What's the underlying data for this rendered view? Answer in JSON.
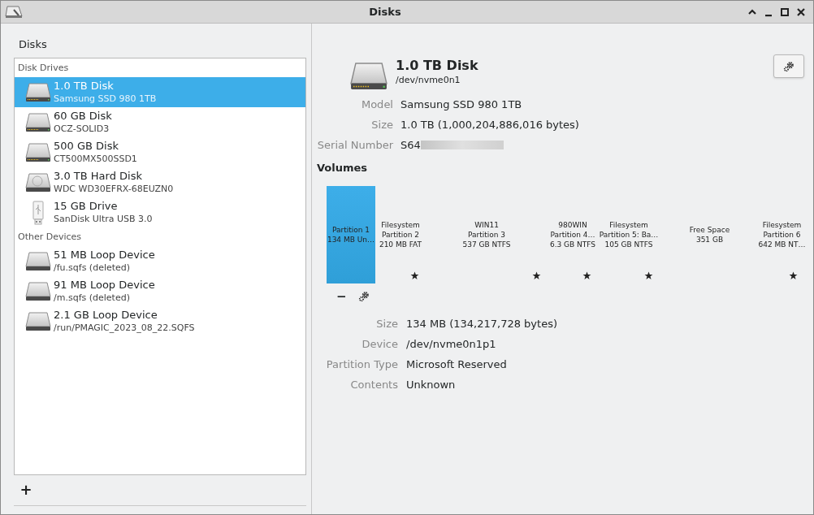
{
  "window": {
    "title": "Disks"
  },
  "heading": "Disks",
  "sections": [
    {
      "title": "Disk Drives",
      "items": [
        {
          "kind": "ssd",
          "name": "1.0 TB Disk",
          "detail": "Samsung SSD 980 1TB",
          "selected": true
        },
        {
          "kind": "ssd",
          "name": "60 GB Disk",
          "detail": "OCZ-SOLID3",
          "selected": false
        },
        {
          "kind": "ssd",
          "name": "500 GB Disk",
          "detail": "CT500MX500SSD1",
          "selected": false
        },
        {
          "kind": "hdd",
          "name": "3.0 TB Hard Disk",
          "detail": "WDC WD30EFRX-68EUZN0",
          "selected": false
        },
        {
          "kind": "usb",
          "name": "15 GB Drive",
          "detail": "SanDisk Ultra USB 3.0",
          "selected": false
        }
      ]
    },
    {
      "title": "Other Devices",
      "items": [
        {
          "kind": "loop",
          "name": "51 MB Loop Device",
          "detail": "/fu.sqfs (deleted)",
          "selected": false
        },
        {
          "kind": "loop",
          "name": "91 MB Loop Device",
          "detail": "/m.sqfs (deleted)",
          "selected": false
        },
        {
          "kind": "loop",
          "name": "2.1 GB Loop Device",
          "detail": "/run/PMAGIC_2023_08_22.SQFS",
          "selected": false
        }
      ]
    }
  ],
  "add_button": "+",
  "disk": {
    "title": "1.0 TB Disk",
    "device": "/dev/nvme0n1",
    "properties": [
      {
        "label": "Model",
        "value": "Samsung SSD 980 1TB"
      },
      {
        "label": "Size",
        "value": "1.0 TB (1,000,204,886,016 bytes)"
      },
      {
        "label": "Serial Number",
        "value": "S64",
        "redacted": true
      }
    ]
  },
  "volumes_title": "Volumes",
  "volumes": [
    {
      "lines": [
        "Partition 1",
        "134 MB Un…"
      ],
      "selected": true,
      "mounted": false
    },
    {
      "lines": [
        "Filesystem",
        "Partition 2",
        "210 MB FAT"
      ],
      "selected": false,
      "mounted": true
    },
    {
      "lines": [
        "WIN11",
        "Partition 3",
        "537 GB NTFS"
      ],
      "selected": false,
      "mounted": true
    },
    {
      "lines": [
        "980WIN",
        "Partition 4…",
        "6.3 GB NTFS"
      ],
      "selected": false,
      "mounted": true
    },
    {
      "lines": [
        "Filesystem",
        "Partition 5: Ba…",
        "105 GB NTFS"
      ],
      "selected": false,
      "mounted": true
    },
    {
      "lines": [
        "Free Space",
        "351 GB"
      ],
      "selected": false,
      "mounted": false
    },
    {
      "lines": [
        "Filesystem",
        "Partition 6",
        "642 MB NT…"
      ],
      "selected": false,
      "mounted": true
    }
  ],
  "volume_actions": [
    "−"
  ],
  "volume_properties": [
    {
      "label": "Size",
      "value": "134 MB (134,217,728 bytes)"
    },
    {
      "label": "Device",
      "value": "/dev/nvme0n1p1"
    },
    {
      "label": "Partition Type",
      "value": "Microsoft Reserved"
    },
    {
      "label": "Contents",
      "value": "Unknown"
    }
  ]
}
